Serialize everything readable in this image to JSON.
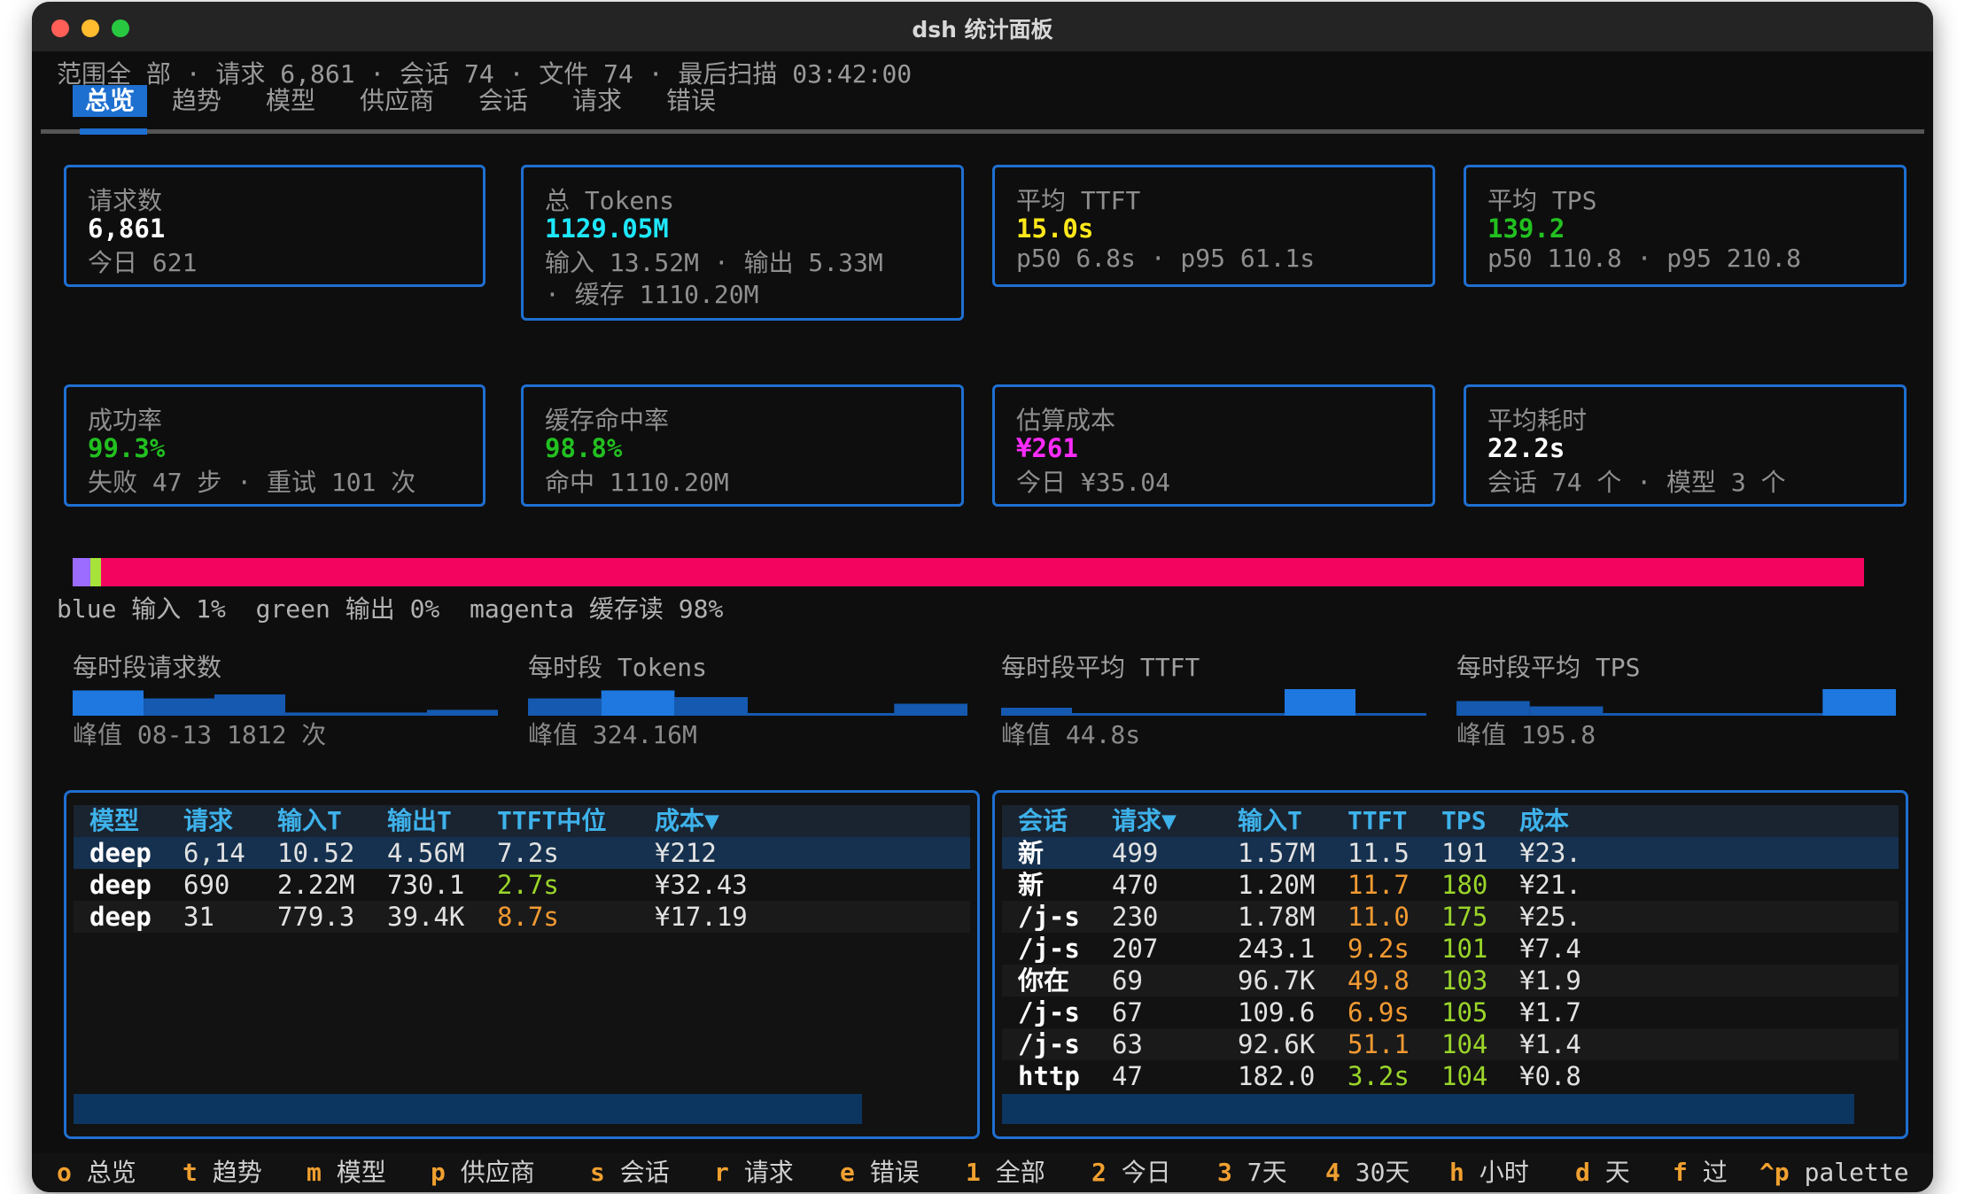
{
  "window": {
    "title": "dsh 统计面板"
  },
  "colors": {
    "accent": "#1f6fd0",
    "cyan": "#1ee8ff",
    "yellow": "#ffe81a",
    "green": "#22c020",
    "magenta": "#ff2bff",
    "orange": "#f29a32",
    "lime": "#9ad52a",
    "key": "#f0a030"
  },
  "scope_line": "范围全 部 · 请求 6,861 · 会话 74 · 文件 74 · 最后扫描 03:42:00",
  "tabs": [
    "总览",
    "趋势",
    "模型",
    "供应商",
    "会话",
    "请求",
    "错误"
  ],
  "cards": [
    {
      "label": "请求数",
      "value": "6,861",
      "sub": "今日 621",
      "color": "#ffffff"
    },
    {
      "label": "总 Tokens",
      "value": "1129.05M",
      "sub": "输入 13.52M · 输出 5.33M",
      "sub2": "· 缓存 1110.20M",
      "color": "#1ee8ff"
    },
    {
      "label": "平均 TTFT",
      "value": "15.0s",
      "sub": "p50 6.8s · p95 61.1s",
      "color": "#ffe81a"
    },
    {
      "label": "平均 TPS",
      "value": "139.2",
      "sub": "p50 110.8 · p95 210.8",
      "color": "#22c020"
    },
    {
      "label": "成功率",
      "value": "99.3%",
      "sub": "失败 47 步 · 重试 101 次",
      "color": "#22c020"
    },
    {
      "label": "缓存命中率",
      "value": "98.8%",
      "sub": "命中 1110.20M",
      "color": "#22c020"
    },
    {
      "label": "估算成本",
      "value": "¥261",
      "sub": "今日 ¥35.04",
      "color": "#ff2bff"
    },
    {
      "label": "平均耗时",
      "value": "22.2s",
      "sub": "会话 74 个 · 模型 3 个",
      "color": "#ffffff"
    }
  ],
  "token_mix": {
    "segments": [
      {
        "name": "输入",
        "percent": 1,
        "color": "#9b6cff"
      },
      {
        "name": "输出",
        "percent": 0.5,
        "color": "#a8e33a"
      },
      {
        "name": "缓存读",
        "percent": 98.5,
        "color": "#f3055f"
      }
    ],
    "legend": "blue 输入 1%  green 输出 0%  magenta 缓存读 98%"
  },
  "sparks": [
    {
      "title": "每时段请求数",
      "peak": "峰值 08-13 1812 次",
      "values": [
        0.95,
        0.65,
        0.8,
        0.12,
        0.12,
        0.22
      ]
    },
    {
      "title": "每时段 Tokens",
      "peak": "峰值 324.16M",
      "values": [
        0.65,
        0.95,
        0.7,
        0.1,
        0.1,
        0.45
      ]
    },
    {
      "title": "每时段平均 TTFT",
      "peak": "峰值 44.8s",
      "values": [
        0.3,
        0.1,
        0.1,
        0.1,
        1.0,
        0.1
      ]
    },
    {
      "title": "每时段平均 TPS",
      "peak": "峰值 195.8",
      "values": [
        0.55,
        0.35,
        0.1,
        0.1,
        0.1,
        1.0
      ]
    }
  ],
  "models_table": {
    "headers": [
      "模型",
      "请求",
      "输入T",
      "输出T",
      "TTFT中位",
      "成本▼"
    ],
    "rows": [
      {
        "cells": [
          "deep",
          "6,14",
          "10.52",
          "4.56M",
          "7.2s",
          "¥212"
        ],
        "ttft_color": "#e2e2e2"
      },
      {
        "cells": [
          "deep",
          "690",
          "2.22M",
          "730.1",
          "2.7s",
          "¥32.43"
        ],
        "ttft_color": "#9ad52a"
      },
      {
        "cells": [
          "deep",
          "31",
          "779.3",
          "39.4K",
          "8.7s",
          "¥17.19"
        ],
        "ttft_color": "#f29a32"
      }
    ]
  },
  "sessions_table": {
    "headers": [
      "会话",
      "请求▼",
      "输入T",
      "TTFT",
      "TPS",
      "成本"
    ],
    "rows": [
      {
        "cells": [
          "新",
          "499",
          "1.57M",
          "11.5",
          "191",
          "¥23."
        ],
        "ttft_color": "#e2e2e2",
        "tps_color": "#e2e2e2"
      },
      {
        "cells": [
          "新",
          "470",
          "1.20M",
          "11.7",
          "180",
          "¥21."
        ],
        "ttft_color": "#f29a32",
        "tps_color": "#9ad52a"
      },
      {
        "cells": [
          "/j-s",
          "230",
          "1.78M",
          "11.0",
          "175",
          "¥25."
        ],
        "ttft_color": "#f29a32",
        "tps_color": "#9ad52a"
      },
      {
        "cells": [
          "/j-s",
          "207",
          "243.1",
          "9.2s",
          "101",
          "¥7.4"
        ],
        "ttft_color": "#f29a32",
        "tps_color": "#9ad52a"
      },
      {
        "cells": [
          "你在",
          "69",
          "96.7K",
          "49.8",
          "103",
          "¥1.9"
        ],
        "ttft_color": "#f29a32",
        "tps_color": "#9ad52a"
      },
      {
        "cells": [
          "/j-s",
          "67",
          "109.6",
          "6.9s",
          "105",
          "¥1.7"
        ],
        "ttft_color": "#f29a32",
        "tps_color": "#9ad52a"
      },
      {
        "cells": [
          "/j-s",
          "63",
          "92.6K",
          "51.1",
          "104",
          "¥1.4"
        ],
        "ttft_color": "#f29a32",
        "tps_color": "#9ad52a"
      },
      {
        "cells": [
          "http",
          "47",
          "182.0",
          "3.2s",
          "104",
          "¥0.8"
        ],
        "ttft_color": "#9ad52a",
        "tps_color": "#9ad52a"
      }
    ]
  },
  "status_keys": [
    {
      "key": "o",
      "label": "总览"
    },
    {
      "key": "t",
      "label": "趋势"
    },
    {
      "key": "m",
      "label": "模型"
    },
    {
      "key": "p",
      "label": "供应商"
    },
    {
      "key": "s",
      "label": "会话"
    },
    {
      "key": "r",
      "label": "请求"
    },
    {
      "key": "e",
      "label": "错误"
    },
    {
      "key": "1",
      "label": "全部"
    },
    {
      "key": "2",
      "label": "今日"
    },
    {
      "key": "3",
      "label": "7天"
    },
    {
      "key": "4",
      "label": "30天"
    },
    {
      "key": "h",
      "label": "小时"
    },
    {
      "key": "d",
      "label": "天"
    },
    {
      "key": "f",
      "label": "过"
    },
    {
      "key": "^p",
      "label": "palette"
    }
  ]
}
